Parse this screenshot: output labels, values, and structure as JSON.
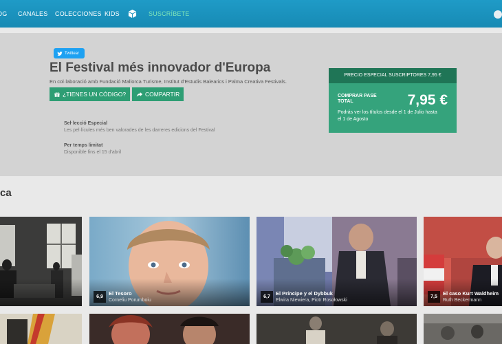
{
  "nav": {
    "items": [
      "OG",
      "CANALES",
      "COLECCIONES",
      "KIDS"
    ],
    "subscribe": "SUSCRÍBETE"
  },
  "hero": {
    "tweet_label": "Twittear",
    "title": "El Festival més innovador d'Europa",
    "description": "En col·laboració amb Fundació Mallorca Turisme, Institut d'Estudis Balearics i Palma Creativa Festivals.",
    "code_button": "¿TIENES UN CÓDIGO?",
    "share_button": "COMPARTIR",
    "info": [
      {
        "label": "Sel·lecció Especial",
        "text": "Les pel·lícules més ben valorades de les darreres edicions del Festival"
      },
      {
        "label": "Per temps limitat",
        "text": "Disponible fins el 15 d'abril"
      }
    ]
  },
  "price": {
    "header": "PRECIO ESPECIAL SUSCRIPTORES 7,95 €",
    "label": "COMPRAR PASE TOTAL",
    "amount": "7,95 €",
    "note": "Podrás ver los títulos desde el 1 de Julio hasta el 1 de Agosto"
  },
  "section": {
    "title": "ca"
  },
  "cards": [
    {
      "rating": "",
      "title": "",
      "subtitle": ""
    },
    {
      "rating": "6,9",
      "title": "El Tesoro",
      "subtitle": "Corneliu Porumboiu"
    },
    {
      "rating": "6,7",
      "title": "El Príncipe y el Dybbuk",
      "subtitle": "Elwira Niewiera, Piotr Rosołowski"
    },
    {
      "rating": "7,5",
      "title": "El caso Kurt Waldheim",
      "subtitle": "Ruth Beckermann"
    }
  ],
  "colors": {
    "nav": "#1f9bc7",
    "accent_green": "#2e9e74",
    "subscribe": "#7de3b8"
  }
}
